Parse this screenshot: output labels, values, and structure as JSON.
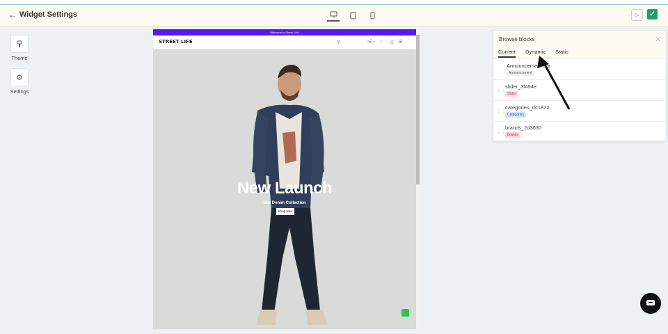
{
  "header": {
    "back_icon": "arrow-left-icon",
    "title": "Widget Settings",
    "devices": [
      "desktop-icon",
      "tablet-icon",
      "mobile-icon"
    ],
    "play_icon": "play-icon",
    "save_icon": "check-icon"
  },
  "sidebar": {
    "items": [
      {
        "label": "Theme",
        "icon": "brush-icon"
      },
      {
        "label": "Settings",
        "icon": "gear-icon"
      }
    ]
  },
  "preview": {
    "announcement": "Welcome to Street Life!",
    "brand": "STREET LIFE",
    "signin": "Sign in",
    "hero_title": "New Launch",
    "hero_subtitle": "Our Denim Collection",
    "cta": "Shop Now"
  },
  "panel": {
    "title": "Browse blocks",
    "tabs": [
      "Current",
      "Dynamic",
      "Static"
    ],
    "active_tab": "Current",
    "blocks": [
      {
        "name": "Announcement bar",
        "badge": "Announcement",
        "badge_color": "#eef0f3"
      },
      {
        "name": "slider_3f494e",
        "badge": "Slider",
        "badge_color": "#f8d7e1"
      },
      {
        "name": "categories_dc1872",
        "badge": "Categories",
        "badge_color": "#cfe3fb"
      },
      {
        "name": "brands_2d3630",
        "badge": "Brands",
        "badge_color": "#fbd4d4"
      }
    ]
  },
  "colors": {
    "accent": "#1f9d6f",
    "announcement_bg": "#5a17f5"
  }
}
